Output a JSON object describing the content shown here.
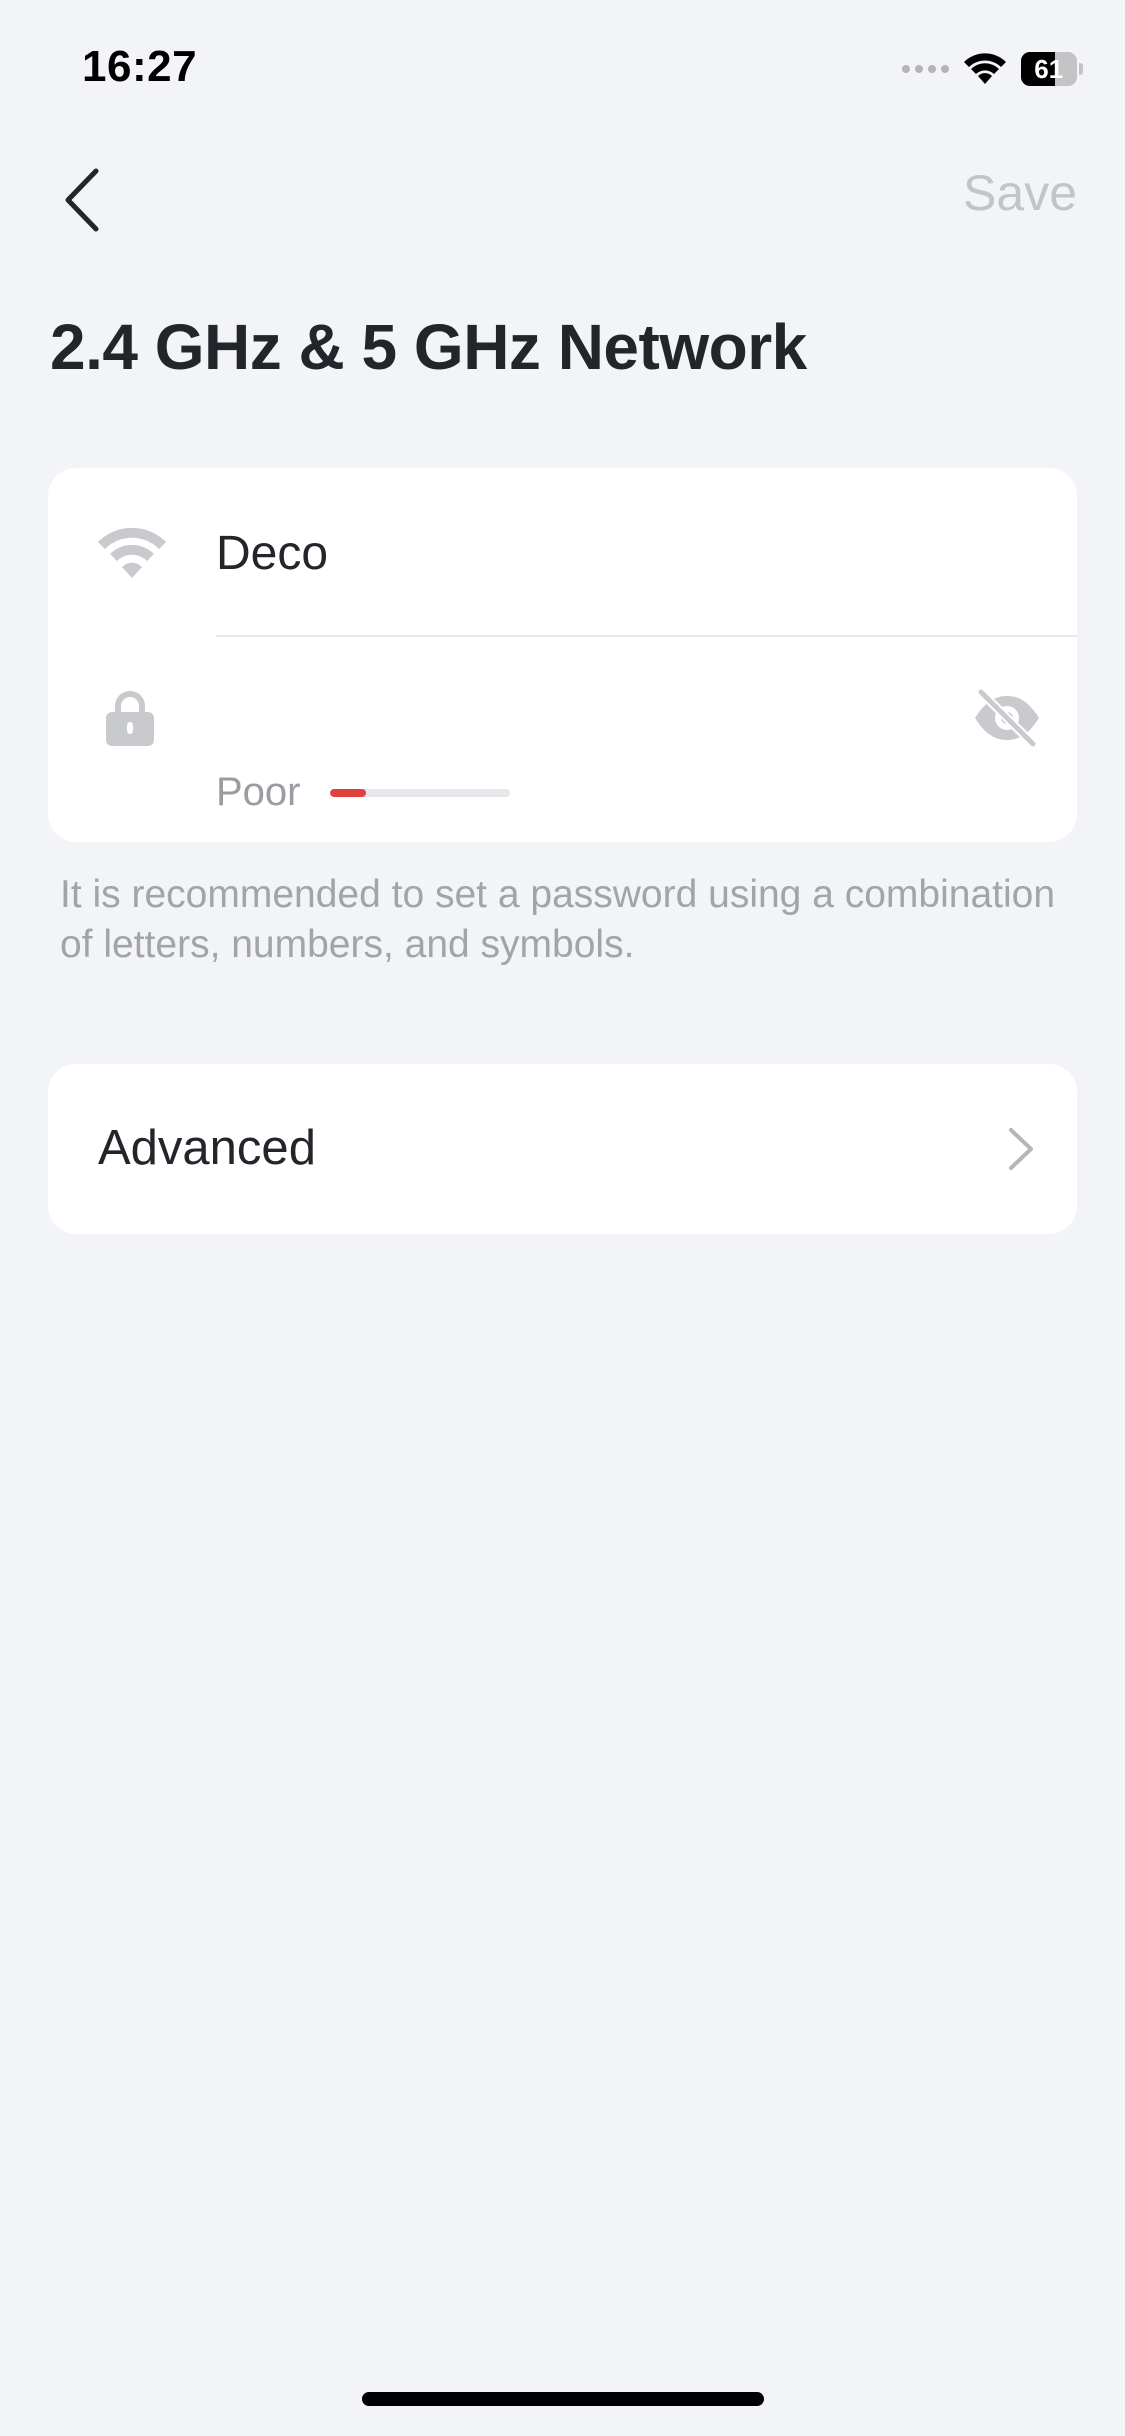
{
  "status_bar": {
    "time": "16:27",
    "battery_level": "61",
    "battery_fraction": 0.61
  },
  "nav": {
    "back_icon": "chevron-left-icon",
    "save_label": "Save"
  },
  "page": {
    "title": "2.4 GHz & 5 GHz Network"
  },
  "network": {
    "ssid_icon": "wifi-icon",
    "ssid_value": "Deco",
    "password_icon": "lock-icon",
    "password_value": "",
    "visibility_icon": "eye-off-icon",
    "strength_label": "Poor",
    "strength_fraction": 0.2,
    "strength_color": "#e0413d"
  },
  "hint": {
    "text": "It is recommended to set a password using a combination of letters, numbers, and symbols."
  },
  "advanced": {
    "label": "Advanced",
    "icon": "chevron-right-icon"
  },
  "colors": {
    "background": "#f3f4f8",
    "card": "#ffffff",
    "muted_text": "#a2a4a9",
    "primary_text": "#23252a"
  }
}
